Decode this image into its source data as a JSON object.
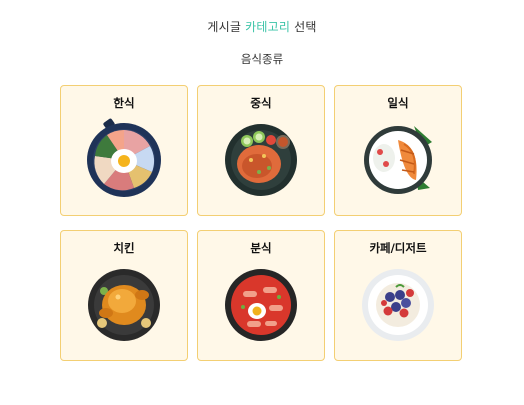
{
  "header": {
    "prefix": "게시글",
    "accent": "카테고리",
    "suffix": "선택",
    "accent_color": "#3cc4a8"
  },
  "section": {
    "title": "음식종류"
  },
  "categories": [
    {
      "label": "한식",
      "icon": "bibimbap-icon"
    },
    {
      "label": "중식",
      "icon": "fried-rice-icon"
    },
    {
      "label": "일식",
      "icon": "tonkatsu-icon"
    },
    {
      "label": "치킨",
      "icon": "roast-chicken-icon"
    },
    {
      "label": "분식",
      "icon": "tteokbokki-icon"
    },
    {
      "label": "카페/디저트",
      "icon": "dessert-bowl-icon"
    }
  ],
  "colors": {
    "card_background": "#fff8e8",
    "card_border": "#f3cf73"
  }
}
